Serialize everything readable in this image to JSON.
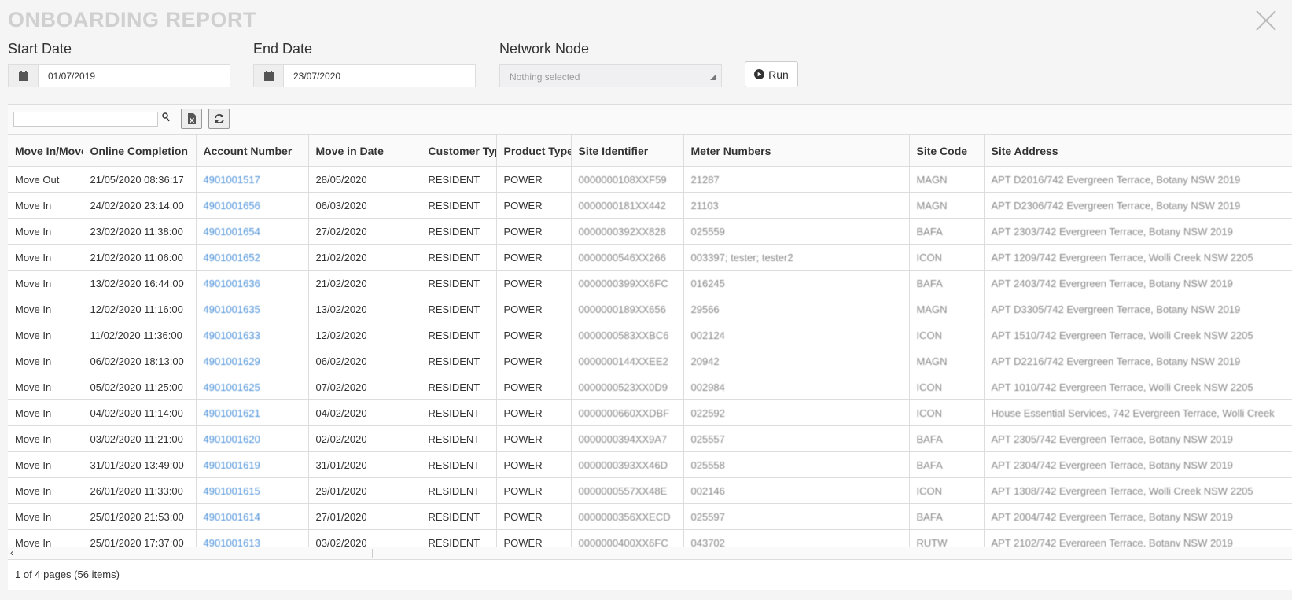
{
  "title": "ONBOARDING REPORT",
  "filters": {
    "start_label": "Start Date",
    "start_value": "01/07/2019",
    "end_label": "End Date",
    "end_value": "23/07/2020",
    "node_label": "Network Node",
    "node_value": "Nothing selected",
    "run_label": "Run"
  },
  "table": {
    "columns": [
      "Move In/Move Out",
      "Online Completion",
      "Account Number",
      "Move in Date",
      "Customer Type",
      "Product Type",
      "Site Identifier",
      "Meter Numbers",
      "Site Code",
      "Site Address"
    ],
    "rows": [
      [
        "Move Out",
        "21/05/2020 08:36:17",
        "4901001517",
        "28/05/2020",
        "RESIDENT",
        "POWER",
        "0000000108XXF59",
        "21287",
        "MAGN",
        "APT D2016/742 Evergreen Terrace, Botany NSW 2019"
      ],
      [
        "Move In",
        "24/02/2020 23:14:00",
        "4901001656",
        "06/03/2020",
        "RESIDENT",
        "POWER",
        "0000000181XX442",
        "21103",
        "MAGN",
        "APT D2306/742 Evergreen Terrace, Botany NSW 2019"
      ],
      [
        "Move In",
        "23/02/2020 11:38:00",
        "4901001654",
        "27/02/2020",
        "RESIDENT",
        "POWER",
        "0000000392XX828",
        "025559",
        "BAFA",
        "APT 2303/742 Evergreen Terrace, Botany NSW 2019"
      ],
      [
        "Move In",
        "21/02/2020 11:06:00",
        "4901001652",
        "21/02/2020",
        "RESIDENT",
        "POWER",
        "0000000546XX266",
        "003397; tester; tester2",
        "ICON",
        "APT 1209/742 Evergreen Terrace, Wolli Creek NSW 2205"
      ],
      [
        "Move In",
        "13/02/2020 16:44:00",
        "4901001636",
        "21/02/2020",
        "RESIDENT",
        "POWER",
        "0000000399XX6FC",
        "016245",
        "BAFA",
        "APT 2403/742 Evergreen Terrace, Botany NSW 2019"
      ],
      [
        "Move In",
        "12/02/2020 11:16:00",
        "4901001635",
        "13/02/2020",
        "RESIDENT",
        "POWER",
        "0000000189XX656",
        "29566",
        "MAGN",
        "APT D3305/742 Evergreen Terrace, Botany NSW 2019"
      ],
      [
        "Move In",
        "11/02/2020 11:36:00",
        "4901001633",
        "12/02/2020",
        "RESIDENT",
        "POWER",
        "0000000583XXBC6",
        "002124",
        "ICON",
        "APT 1510/742 Evergreen Terrace, Wolli Creek NSW 2205"
      ],
      [
        "Move In",
        "06/02/2020 18:13:00",
        "4901001629",
        "06/02/2020",
        "RESIDENT",
        "POWER",
        "0000000144XXEE2",
        "20942",
        "MAGN",
        "APT D2216/742 Evergreen Terrace, Botany NSW 2019"
      ],
      [
        "Move In",
        "05/02/2020 11:25:00",
        "4901001625",
        "07/02/2020",
        "RESIDENT",
        "POWER",
        "0000000523XX0D9",
        "002984",
        "ICON",
        "APT 1010/742 Evergreen Terrace, Wolli Creek NSW 2205"
      ],
      [
        "Move In",
        "04/02/2020 11:14:00",
        "4901001621",
        "04/02/2020",
        "RESIDENT",
        "POWER",
        "0000000660XXDBF",
        "022592",
        "ICON",
        "House Essential Services, 742 Evergreen Terrace, Wolli Creek"
      ],
      [
        "Move In",
        "03/02/2020 11:21:00",
        "4901001620",
        "02/02/2020",
        "RESIDENT",
        "POWER",
        "0000000394XX9A7",
        "025557",
        "BAFA",
        "APT 2305/742 Evergreen Terrace, Botany NSW 2019"
      ],
      [
        "Move In",
        "31/01/2020 13:49:00",
        "4901001619",
        "31/01/2020",
        "RESIDENT",
        "POWER",
        "0000000393XX46D",
        "025558",
        "BAFA",
        "APT 2304/742 Evergreen Terrace, Botany NSW 2019"
      ],
      [
        "Move In",
        "26/01/2020 11:33:00",
        "4901001615",
        "29/01/2020",
        "RESIDENT",
        "POWER",
        "0000000557XX48E",
        "002146",
        "ICON",
        "APT 1308/742 Evergreen Terrace, Wolli Creek NSW 2205"
      ],
      [
        "Move In",
        "25/01/2020 21:53:00",
        "4901001614",
        "27/01/2020",
        "RESIDENT",
        "POWER",
        "0000000356XXECD",
        "025597",
        "BAFA",
        "APT 2004/742 Evergreen Terrace, Botany NSW 2019"
      ],
      [
        "Move In",
        "25/01/2020 17:37:00",
        "4901001613",
        "03/02/2020",
        "RESIDENT",
        "POWER",
        "0000000400XX6FC",
        "043702",
        "RUTW",
        "APT 2102/742 Evergreen Terrace, Botany NSW 2019"
      ]
    ]
  },
  "footer": "1 of 4 pages (56 items)",
  "icons": {
    "close": "close-icon",
    "calendar": "calendar-icon",
    "run": "play-circle-icon",
    "search": "search-icon",
    "excel": "excel-export-icon",
    "refresh": "refresh-icon"
  }
}
